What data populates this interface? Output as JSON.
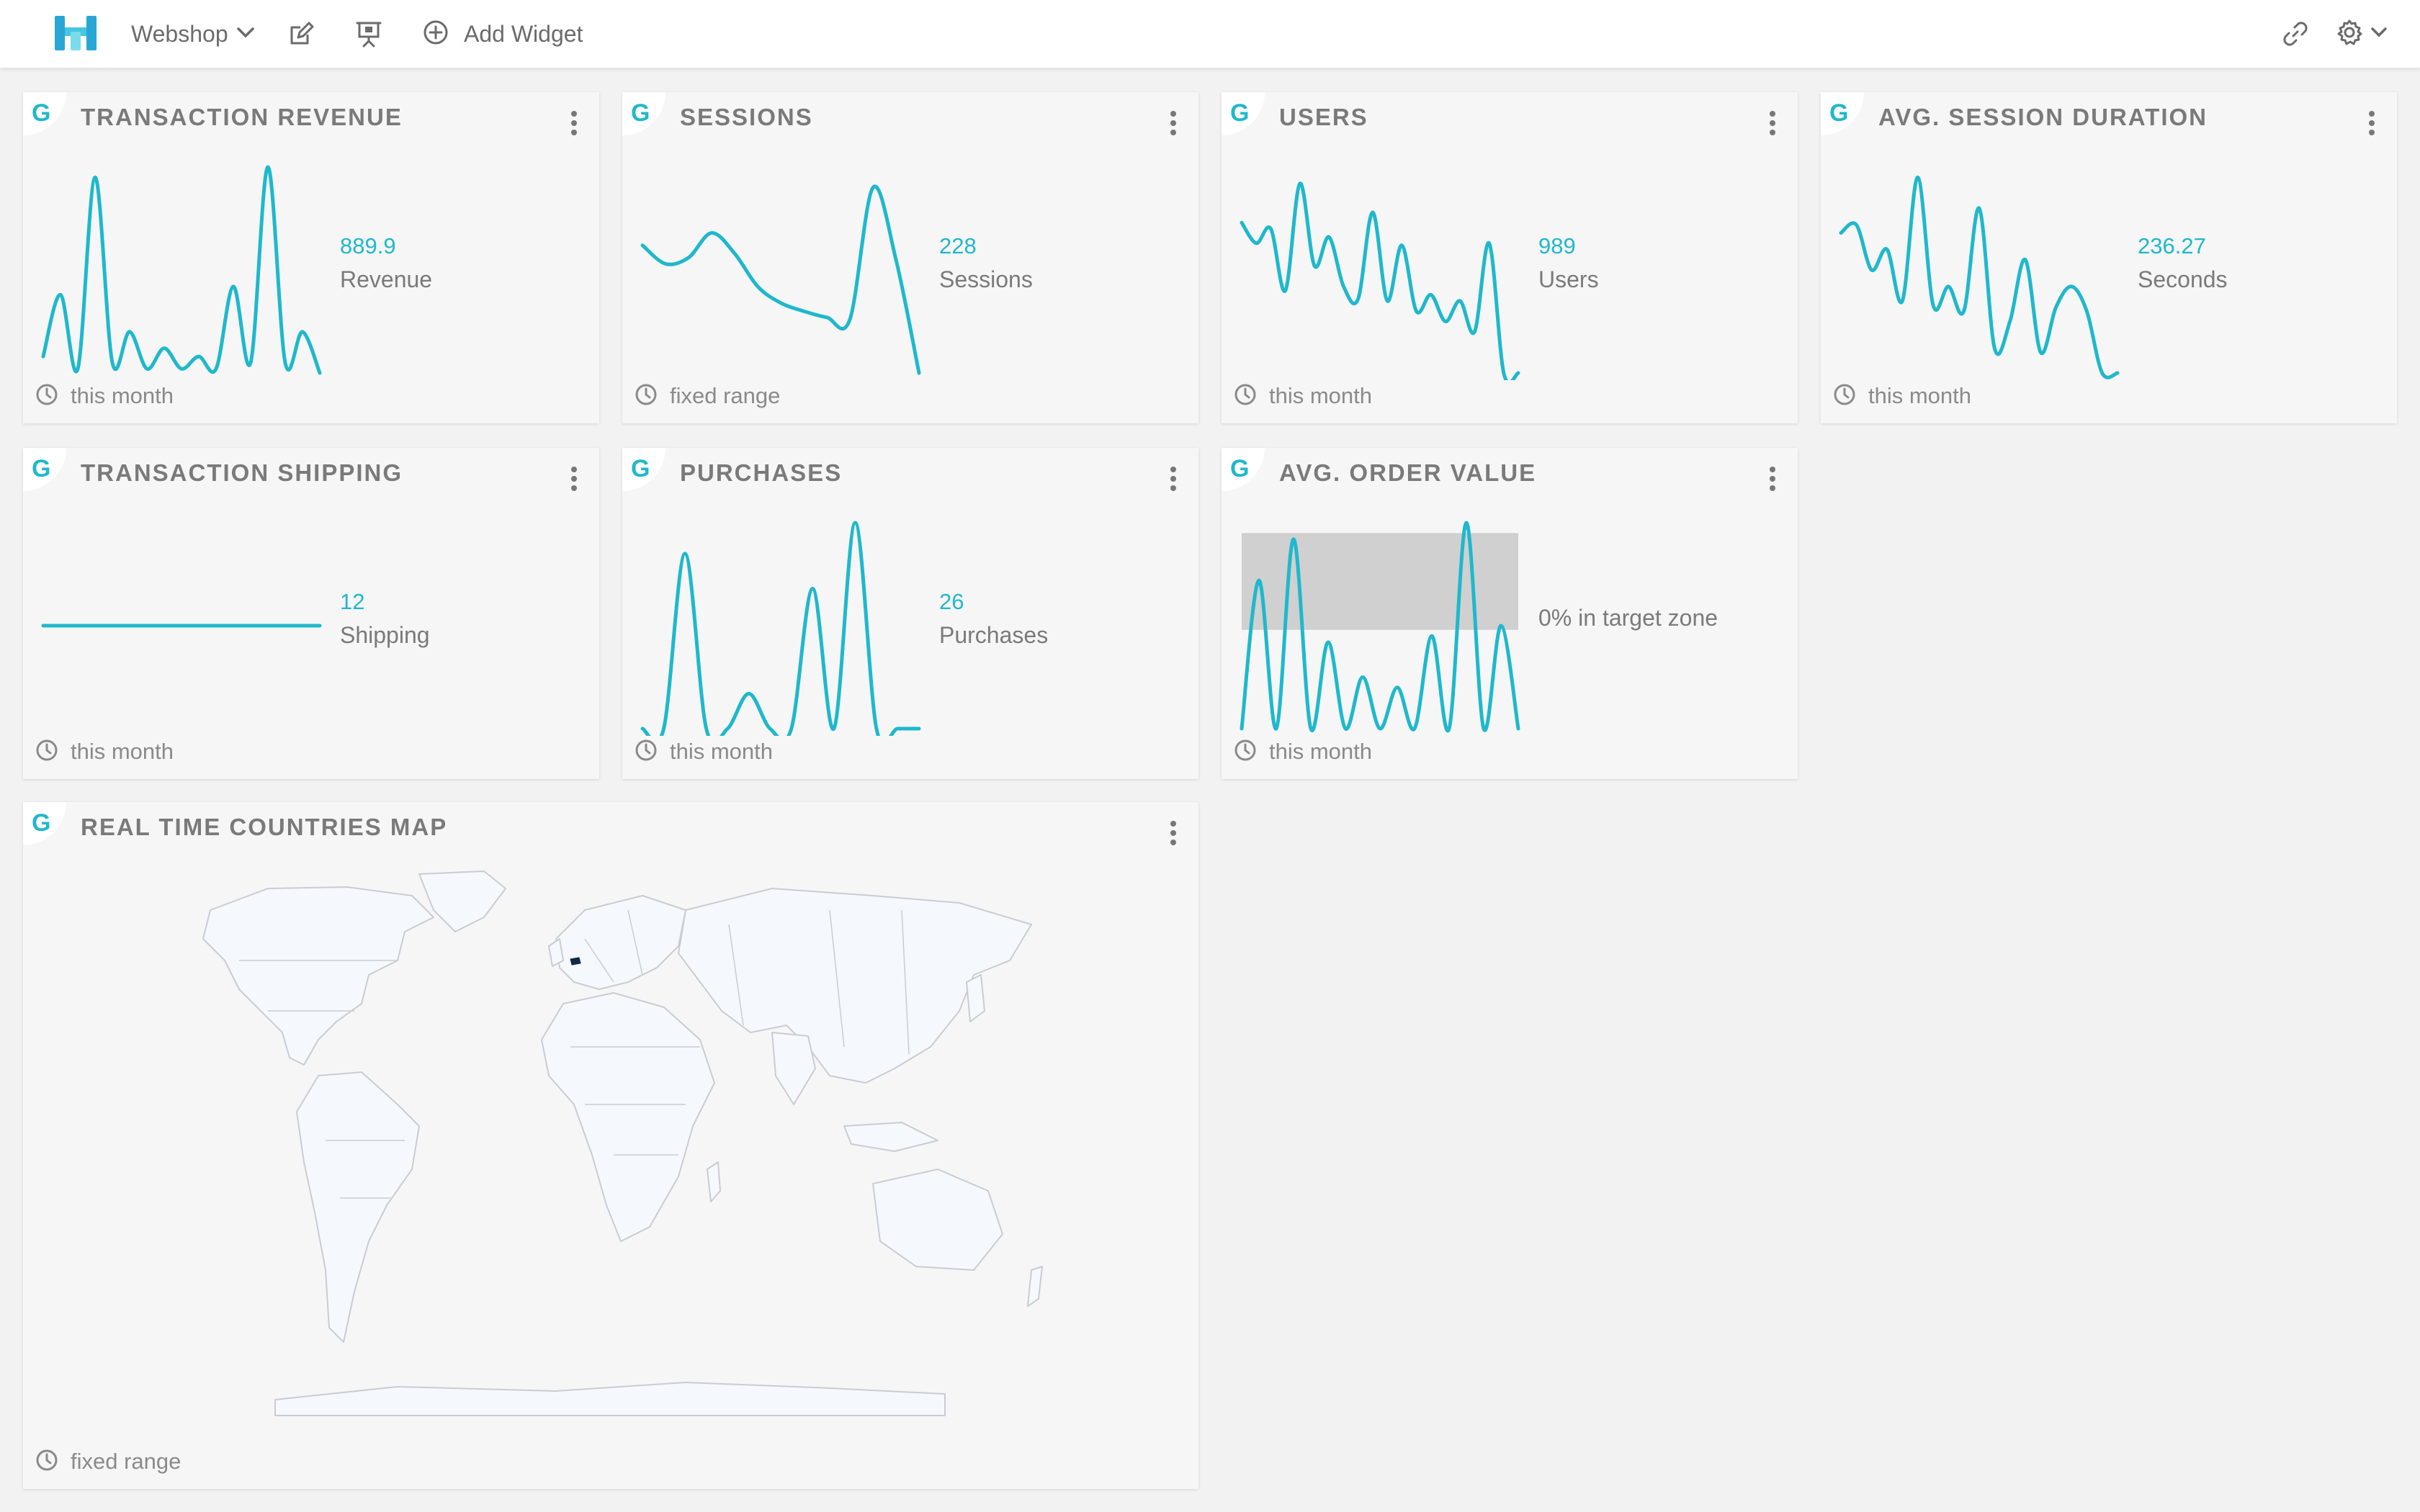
{
  "header": {
    "dashboard_name": "Webshop",
    "add_widget_label": "Add Widget"
  },
  "colors": {
    "accent": "#1fb8cc",
    "card": "#f6f6f6",
    "target_zone": "#d0d0d0",
    "map_land": "#f5f8fc",
    "map_highlight": "#0e2a46"
  },
  "widgets": {
    "transaction_revenue": {
      "title": "TRANSACTION REVENUE",
      "value": "889.9",
      "unit": "Revenue",
      "range": "this month",
      "spark": [
        0.08,
        0.38,
        0.02,
        0.95,
        0.05,
        0.2,
        0.02,
        0.12,
        0.02,
        0.08,
        0.02,
        0.42,
        0.05,
        1.0,
        0.05,
        0.2,
        0.0
      ]
    },
    "sessions": {
      "title": "SESSIONS",
      "value": "228",
      "unit": "Sessions",
      "range": "fixed range",
      "spark": [
        0.62,
        0.53,
        0.56,
        0.68,
        0.58,
        0.42,
        0.34,
        0.3,
        0.27,
        0.26,
        0.9,
        0.55,
        0.0
      ]
    },
    "users": {
      "title": "USERS",
      "value": "989",
      "unit": "Users",
      "range": "this month",
      "spark": [
        0.73,
        0.63,
        0.7,
        0.4,
        0.92,
        0.52,
        0.66,
        0.42,
        0.36,
        0.78,
        0.35,
        0.62,
        0.3,
        0.38,
        0.25,
        0.35,
        0.2,
        0.63,
        0.0,
        0.0
      ]
    },
    "avg_session_duration": {
      "title": "AVG. SESSION DURATION",
      "value": "236.27",
      "unit": "Seconds",
      "range": "this month",
      "spark": [
        0.68,
        0.72,
        0.5,
        0.6,
        0.35,
        0.95,
        0.33,
        0.42,
        0.3,
        0.8,
        0.12,
        0.25,
        0.55,
        0.1,
        0.32,
        0.42,
        0.3,
        0.0,
        0.0
      ]
    },
    "transaction_shipping": {
      "title": "TRANSACTION SHIPPING",
      "value": "12",
      "unit": "Shipping",
      "range": "this month",
      "spark": [
        0.5,
        0.5
      ]
    },
    "purchases": {
      "title": "PURCHASES",
      "value": "26",
      "unit": "Purchases",
      "range": "this month",
      "spark": [
        0.0,
        0.0,
        0.85,
        0.0,
        0.0,
        0.17,
        0.0,
        0.0,
        0.68,
        0.0,
        1.0,
        0.0,
        0.0,
        0.0
      ]
    },
    "avg_order_value": {
      "title": "AVG. ORDER VALUE",
      "target_text": "0% in target zone",
      "range": "this month",
      "target_zone": [
        0.48,
        0.95
      ],
      "spark": [
        0.0,
        0.72,
        0.0,
        0.92,
        0.0,
        0.42,
        0.0,
        0.25,
        0.0,
        0.2,
        0.0,
        0.45,
        0.0,
        1.0,
        0.0,
        0.5,
        0.0
      ]
    },
    "real_time_countries_map": {
      "title": "REAL TIME COUNTRIES MAP",
      "range": "fixed range"
    }
  }
}
